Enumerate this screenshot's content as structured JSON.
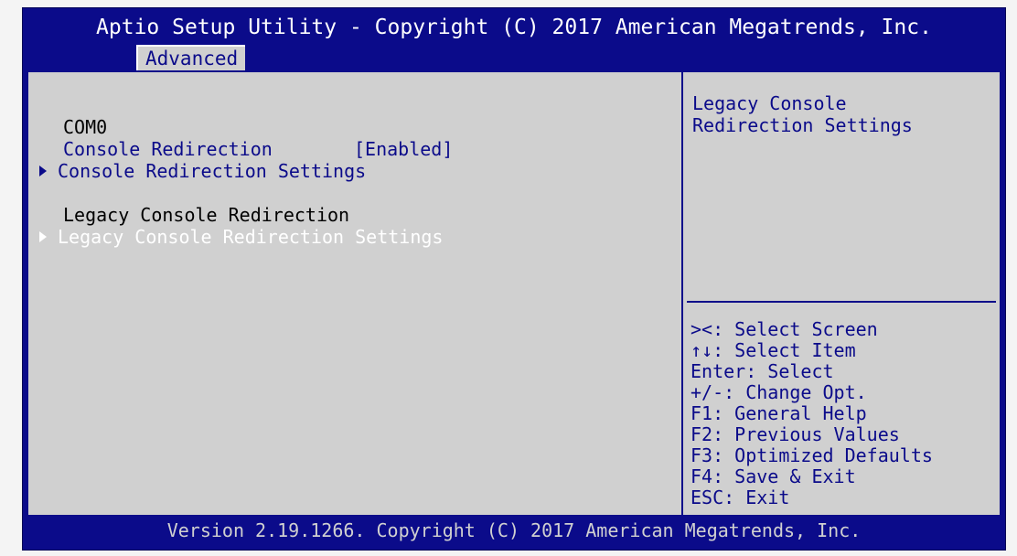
{
  "header": {
    "title": "Aptio Setup Utility - Copyright (C) 2017 American Megatrends, Inc.",
    "active_tab": "Advanced"
  },
  "main": {
    "com_label": "COM0",
    "console_redirection": {
      "label": "Console Redirection",
      "value": "[Enabled]"
    },
    "console_redirection_settings": "Console Redirection Settings",
    "legacy_label": "Legacy Console Redirection",
    "legacy_settings": "Legacy Console Redirection Settings"
  },
  "help": {
    "description": "Legacy Console\nRedirection Settings",
    "keys": [
      "><: Select Screen",
      "↑↓: Select Item",
      "Enter: Select",
      "+/-: Change Opt.",
      "F1: General Help",
      "F2: Previous Values",
      "F3: Optimized Defaults",
      "F4: Save & Exit",
      "ESC: Exit"
    ]
  },
  "footer": {
    "text": "Version 2.19.1266. Copyright (C) 2017 American Megatrends, Inc."
  },
  "colors": {
    "frame_blue": "#0b0b8a",
    "panel_gray": "#d0d0d0",
    "highlight_white": "#ffffff"
  }
}
